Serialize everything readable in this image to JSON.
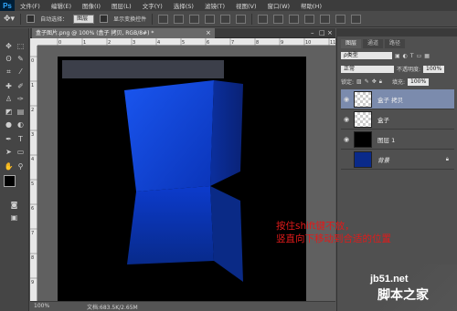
{
  "app": {
    "logo": "Ps"
  },
  "menu": [
    "文件(F)",
    "编辑(E)",
    "图像(I)",
    "图层(L)",
    "文字(Y)",
    "选择(S)",
    "滤镜(T)",
    "视图(V)",
    "窗口(W)",
    "帮助(H)"
  ],
  "options": {
    "auto_select_label": "自动选择：",
    "auto_select_value": "图层",
    "show_transform_label": "显示变换控件"
  },
  "document": {
    "tab_title": "盒子图片.png @ 100% (盒子 拷贝, RGB/8#) *",
    "status": "文档:683.5K/2.65M",
    "ruler_top": [
      "0",
      "1",
      "2",
      "3",
      "4",
      "5",
      "6",
      "7",
      "8",
      "9",
      "10",
      "11"
    ],
    "ruler_left": [
      "0",
      "1",
      "2",
      "3",
      "4",
      "5",
      "6",
      "7",
      "8",
      "9"
    ]
  },
  "layers_panel": {
    "tabs": [
      "图层",
      "通道",
      "路径"
    ],
    "filter_label": "ρ类型",
    "blend_mode": "正常",
    "opacity_label": "不透明度:",
    "opacity_value": "100%",
    "lock_label": "锁定:",
    "fill_label": "填充:",
    "fill_value": "100%",
    "layers": [
      {
        "name": "盒子 拷贝",
        "selected": true,
        "visible": true
      },
      {
        "name": "盒子",
        "selected": false,
        "visible": true
      },
      {
        "name": "图层 1",
        "selected": false,
        "visible": true
      },
      {
        "name": "背景",
        "selected": false,
        "visible": false
      }
    ]
  },
  "annotation": {
    "line1": "按住shift键不放，",
    "line2": "竖直向下移动到合适的位置"
  },
  "watermark": {
    "en": "jb51.net",
    "cn": "脚本之家"
  },
  "colors": {
    "accent": "#0a4fe0",
    "annotation": "#e01a1a",
    "selected_layer": "#7b8bad"
  }
}
